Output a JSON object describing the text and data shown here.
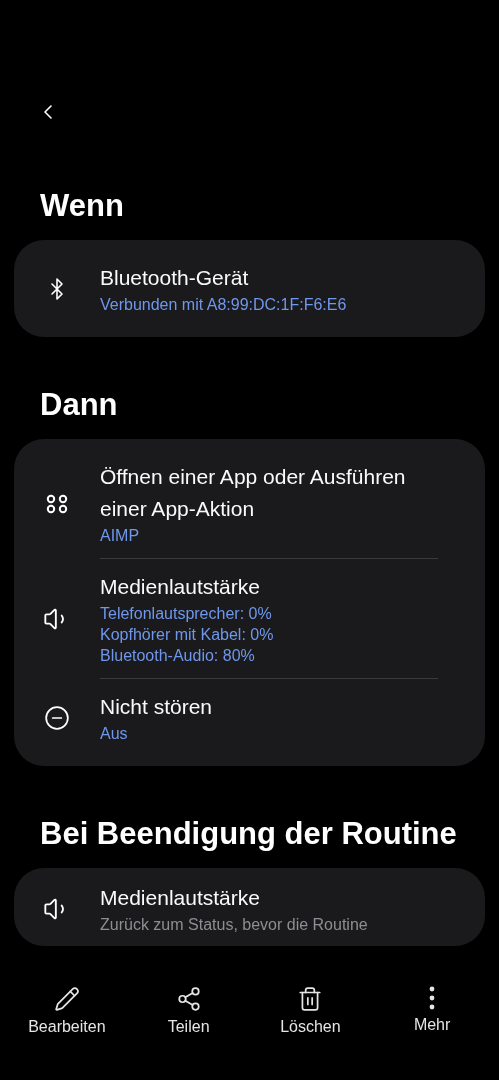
{
  "sections": [
    {
      "heading": "Wenn",
      "items": [
        {
          "kind": "bluetooth",
          "title": "Bluetooth-Gerät",
          "lines": [
            "Verbunden mit A8:99:DC:1F:F6:E6"
          ],
          "muted": false
        }
      ]
    },
    {
      "heading": "Dann",
      "items": [
        {
          "kind": "apps",
          "title": "Öffnen einer App oder Ausführen einer App-Aktion",
          "lines": [
            "AIMP"
          ],
          "muted": false
        },
        {
          "kind": "volume",
          "title": "Medienlautstärke",
          "lines": [
            "Telefonlautsprecher: 0%",
            "Kopfhörer mit Kabel: 0%",
            "Bluetooth-Audio: 80%"
          ],
          "muted": false
        },
        {
          "kind": "dnd",
          "title": "Nicht stören",
          "lines": [
            "Aus"
          ],
          "muted": false
        }
      ]
    },
    {
      "heading": "Bei Beendigung der Routine",
      "items": [
        {
          "kind": "volume",
          "title": "Medienlautstärke",
          "lines": [
            "Zurück zum Status, bevor die Routine"
          ],
          "muted": true
        }
      ]
    }
  ],
  "actions": [
    {
      "kind": "edit",
      "label": "Bearbeiten"
    },
    {
      "kind": "share",
      "label": "Teilen"
    },
    {
      "kind": "delete",
      "label": "Löschen"
    },
    {
      "kind": "more",
      "label": "Mehr"
    }
  ]
}
